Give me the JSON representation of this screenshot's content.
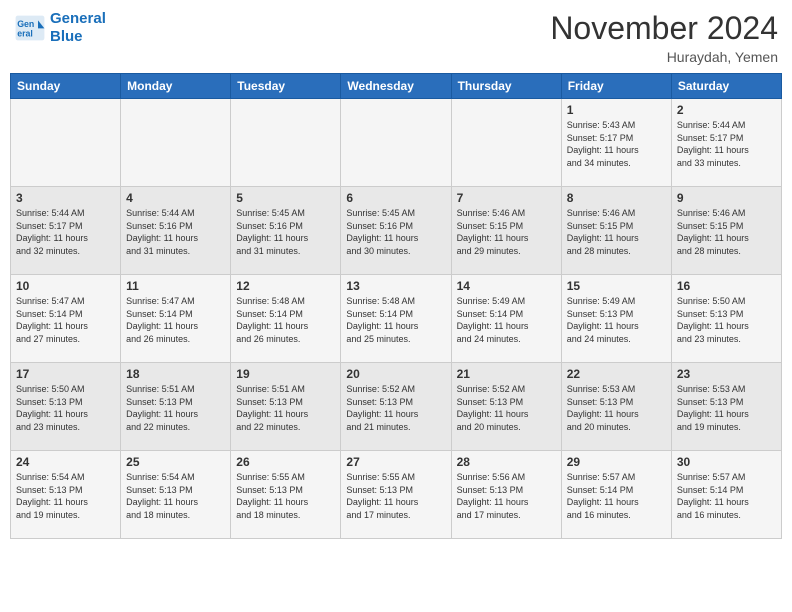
{
  "header": {
    "logo_line1": "General",
    "logo_line2": "Blue",
    "month_title": "November 2024",
    "location": "Huraydah, Yemen"
  },
  "weekdays": [
    "Sunday",
    "Monday",
    "Tuesday",
    "Wednesday",
    "Thursday",
    "Friday",
    "Saturday"
  ],
  "weeks": [
    [
      {
        "day": "",
        "info": ""
      },
      {
        "day": "",
        "info": ""
      },
      {
        "day": "",
        "info": ""
      },
      {
        "day": "",
        "info": ""
      },
      {
        "day": "",
        "info": ""
      },
      {
        "day": "1",
        "info": "Sunrise: 5:43 AM\nSunset: 5:17 PM\nDaylight: 11 hours\nand 34 minutes."
      },
      {
        "day": "2",
        "info": "Sunrise: 5:44 AM\nSunset: 5:17 PM\nDaylight: 11 hours\nand 33 minutes."
      }
    ],
    [
      {
        "day": "3",
        "info": "Sunrise: 5:44 AM\nSunset: 5:17 PM\nDaylight: 11 hours\nand 32 minutes."
      },
      {
        "day": "4",
        "info": "Sunrise: 5:44 AM\nSunset: 5:16 PM\nDaylight: 11 hours\nand 31 minutes."
      },
      {
        "day": "5",
        "info": "Sunrise: 5:45 AM\nSunset: 5:16 PM\nDaylight: 11 hours\nand 31 minutes."
      },
      {
        "day": "6",
        "info": "Sunrise: 5:45 AM\nSunset: 5:16 PM\nDaylight: 11 hours\nand 30 minutes."
      },
      {
        "day": "7",
        "info": "Sunrise: 5:46 AM\nSunset: 5:15 PM\nDaylight: 11 hours\nand 29 minutes."
      },
      {
        "day": "8",
        "info": "Sunrise: 5:46 AM\nSunset: 5:15 PM\nDaylight: 11 hours\nand 28 minutes."
      },
      {
        "day": "9",
        "info": "Sunrise: 5:46 AM\nSunset: 5:15 PM\nDaylight: 11 hours\nand 28 minutes."
      }
    ],
    [
      {
        "day": "10",
        "info": "Sunrise: 5:47 AM\nSunset: 5:14 PM\nDaylight: 11 hours\nand 27 minutes."
      },
      {
        "day": "11",
        "info": "Sunrise: 5:47 AM\nSunset: 5:14 PM\nDaylight: 11 hours\nand 26 minutes."
      },
      {
        "day": "12",
        "info": "Sunrise: 5:48 AM\nSunset: 5:14 PM\nDaylight: 11 hours\nand 26 minutes."
      },
      {
        "day": "13",
        "info": "Sunrise: 5:48 AM\nSunset: 5:14 PM\nDaylight: 11 hours\nand 25 minutes."
      },
      {
        "day": "14",
        "info": "Sunrise: 5:49 AM\nSunset: 5:14 PM\nDaylight: 11 hours\nand 24 minutes."
      },
      {
        "day": "15",
        "info": "Sunrise: 5:49 AM\nSunset: 5:13 PM\nDaylight: 11 hours\nand 24 minutes."
      },
      {
        "day": "16",
        "info": "Sunrise: 5:50 AM\nSunset: 5:13 PM\nDaylight: 11 hours\nand 23 minutes."
      }
    ],
    [
      {
        "day": "17",
        "info": "Sunrise: 5:50 AM\nSunset: 5:13 PM\nDaylight: 11 hours\nand 23 minutes."
      },
      {
        "day": "18",
        "info": "Sunrise: 5:51 AM\nSunset: 5:13 PM\nDaylight: 11 hours\nand 22 minutes."
      },
      {
        "day": "19",
        "info": "Sunrise: 5:51 AM\nSunset: 5:13 PM\nDaylight: 11 hours\nand 22 minutes."
      },
      {
        "day": "20",
        "info": "Sunrise: 5:52 AM\nSunset: 5:13 PM\nDaylight: 11 hours\nand 21 minutes."
      },
      {
        "day": "21",
        "info": "Sunrise: 5:52 AM\nSunset: 5:13 PM\nDaylight: 11 hours\nand 20 minutes."
      },
      {
        "day": "22",
        "info": "Sunrise: 5:53 AM\nSunset: 5:13 PM\nDaylight: 11 hours\nand 20 minutes."
      },
      {
        "day": "23",
        "info": "Sunrise: 5:53 AM\nSunset: 5:13 PM\nDaylight: 11 hours\nand 19 minutes."
      }
    ],
    [
      {
        "day": "24",
        "info": "Sunrise: 5:54 AM\nSunset: 5:13 PM\nDaylight: 11 hours\nand 19 minutes."
      },
      {
        "day": "25",
        "info": "Sunrise: 5:54 AM\nSunset: 5:13 PM\nDaylight: 11 hours\nand 18 minutes."
      },
      {
        "day": "26",
        "info": "Sunrise: 5:55 AM\nSunset: 5:13 PM\nDaylight: 11 hours\nand 18 minutes."
      },
      {
        "day": "27",
        "info": "Sunrise: 5:55 AM\nSunset: 5:13 PM\nDaylight: 11 hours\nand 17 minutes."
      },
      {
        "day": "28",
        "info": "Sunrise: 5:56 AM\nSunset: 5:13 PM\nDaylight: 11 hours\nand 17 minutes."
      },
      {
        "day": "29",
        "info": "Sunrise: 5:57 AM\nSunset: 5:14 PM\nDaylight: 11 hours\nand 16 minutes."
      },
      {
        "day": "30",
        "info": "Sunrise: 5:57 AM\nSunset: 5:14 PM\nDaylight: 11 hours\nand 16 minutes."
      }
    ]
  ]
}
